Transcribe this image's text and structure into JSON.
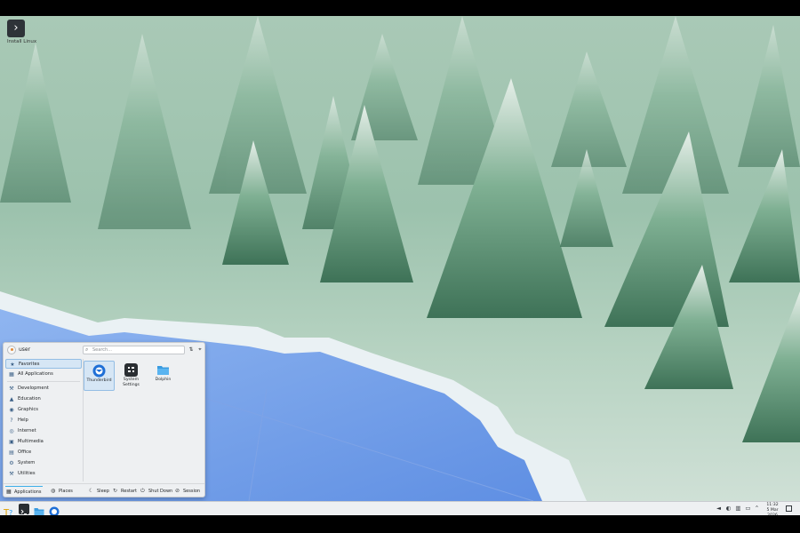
{
  "desktop": {
    "installer_label": "Install Linux",
    "installer_icon": "chevron-right-icon"
  },
  "launcher": {
    "username": "user",
    "search_placeholder": "Search...",
    "categories": [
      {
        "label": "Favorites",
        "icon": "star-icon",
        "selected": true
      },
      {
        "label": "All Applications",
        "icon": "grid-icon"
      },
      {
        "label": "Development",
        "icon": "wrench-icon"
      },
      {
        "label": "Education",
        "icon": "graduation-icon"
      },
      {
        "label": "Graphics",
        "icon": "palette-icon"
      },
      {
        "label": "Help",
        "icon": "help-icon"
      },
      {
        "label": "Internet",
        "icon": "globe-icon"
      },
      {
        "label": "Multimedia",
        "icon": "film-icon"
      },
      {
        "label": "Office",
        "icon": "briefcase-icon"
      },
      {
        "label": "System",
        "icon": "gear-icon"
      },
      {
        "label": "Utilities",
        "icon": "tools-icon"
      }
    ],
    "apps": [
      {
        "label": "Thunderbird",
        "icon": "thunderbird-icon",
        "selected": true
      },
      {
        "label": "System Settings",
        "icon": "system-settings-icon"
      },
      {
        "label": "Dolphin",
        "icon": "folder-icon"
      }
    ],
    "footer": {
      "applications": "Applications",
      "places": "Places",
      "sleep": "Sleep",
      "restart": "Restart",
      "shutdown": "Shut Down",
      "session": "Session"
    }
  },
  "taskbar": {
    "time": "11:32",
    "date": "5 Mar 2026"
  },
  "colors": {
    "accent": "#3daee9",
    "panel": "#eef0f2",
    "selection": "#d6e6f5"
  }
}
